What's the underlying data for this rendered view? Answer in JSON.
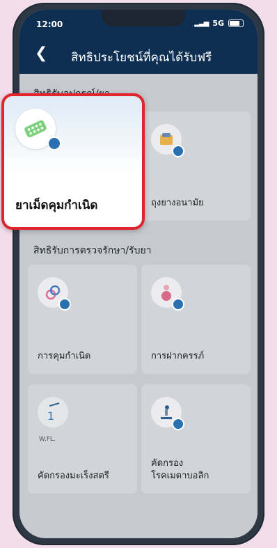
{
  "status": {
    "time": "12:00",
    "network": "5G"
  },
  "header": {
    "title": "สิทธิประโยชน์ที่คุณได้รับฟรี"
  },
  "sections": [
    {
      "title": "สิทธิรับอุปกรณ์/ยา"
    },
    {
      "title": "สิทธิรับการตรวจรักษา/รับยา"
    }
  ],
  "cards": {
    "pill": "ยาเม็ดคุมกำเนิด",
    "condom": "ถุงยางอนามัย",
    "contraception": "การคุมกำเนิด",
    "prenatal": "การฝากครรภ์",
    "cervical_screening": "คัดกรองมะเร็งสตรี",
    "metabolic_line1": "คัดกรอง",
    "metabolic_line2": "โรคเมตาบอลิก",
    "sublabel": "W.FL."
  },
  "colors": {
    "header": "#0f2f52",
    "highlight_border": "#e0252d",
    "badge": "#2a6fb0"
  }
}
